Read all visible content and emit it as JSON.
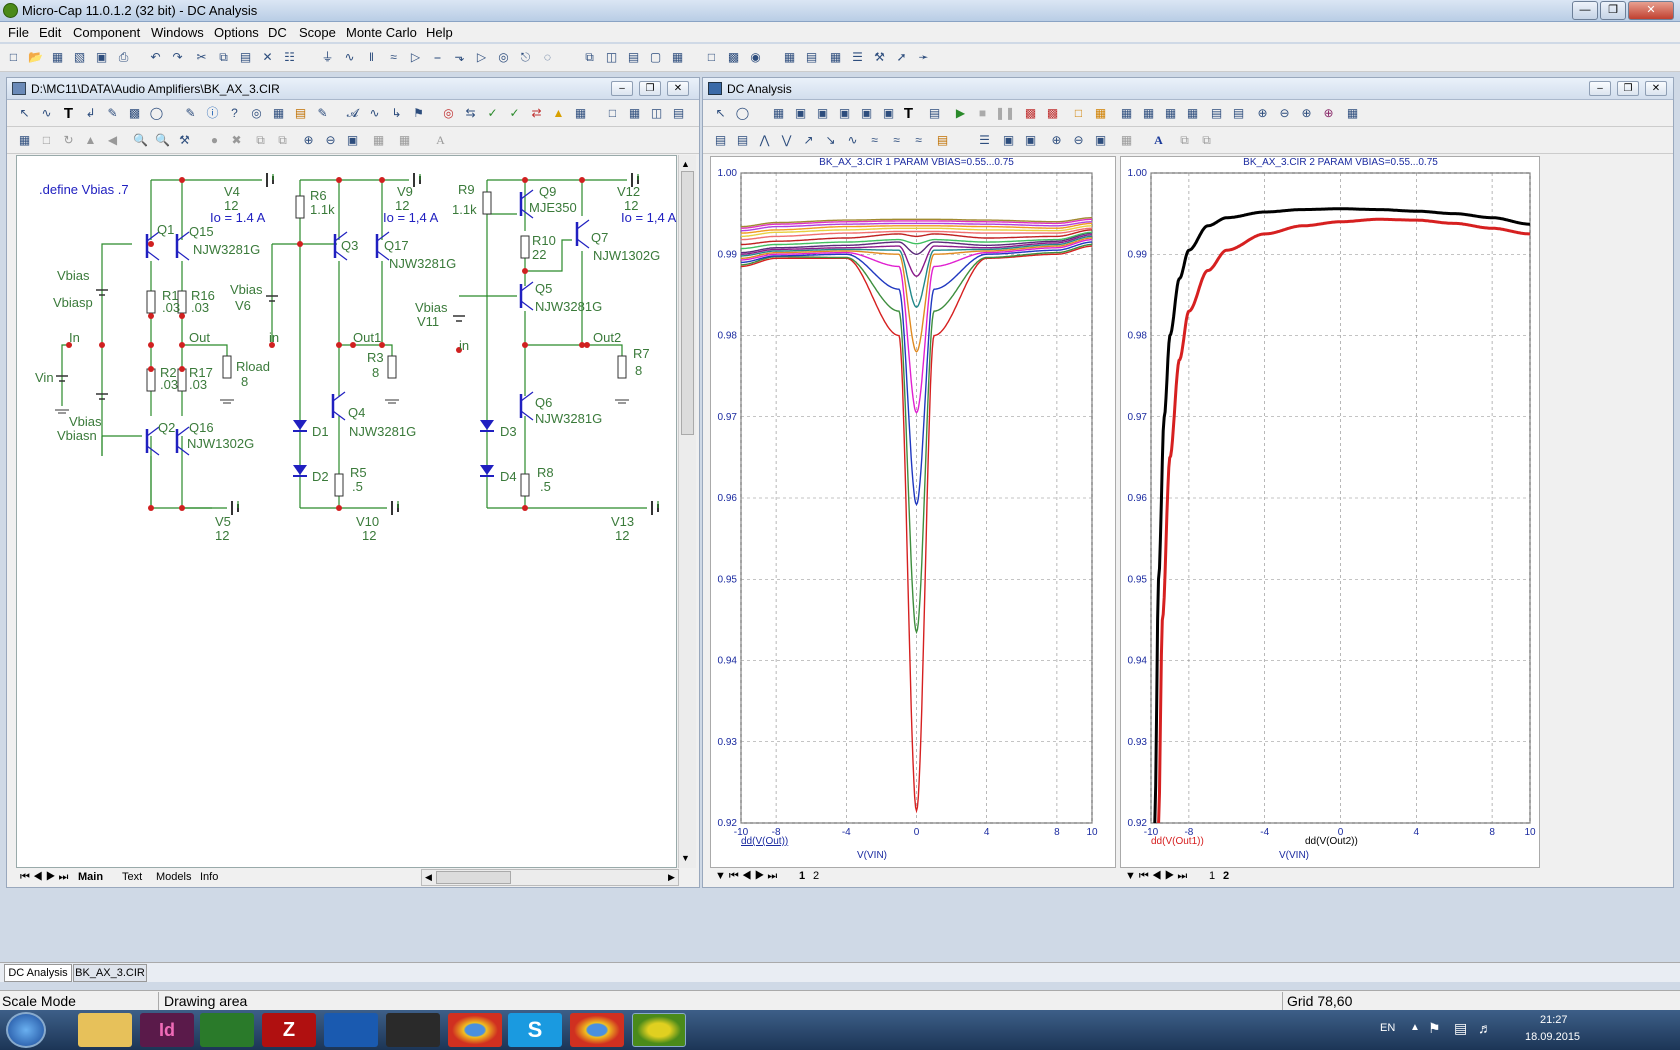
{
  "app": {
    "title": "Micro-Cap 11.0.1.2 (32 bit) - DC Analysis"
  },
  "menu": [
    "File",
    "Edit",
    "Component",
    "Windows",
    "Options",
    "DC",
    "Scope",
    "Monte Carlo",
    "Help"
  ],
  "schematic": {
    "title": "D:\\MC11\\DATA\\Audio Amplifiers\\BK_AX_3.CIR",
    "tabs": [
      "Main",
      "Text",
      "Models",
      "Info"
    ],
    "define": ".define Vbias .7",
    "labels": [
      {
        "t": "Q1",
        "c": "g"
      },
      {
        "t": "Q15",
        "c": "g"
      },
      {
        "t": "NJW3281G",
        "c": "g"
      },
      {
        "t": "V4",
        "c": "g"
      },
      {
        "t": "12",
        "c": "g"
      },
      {
        "t": "Io = 1.4 A",
        "c": "b"
      },
      {
        "t": "Vbias",
        "c": "g"
      },
      {
        "t": "Vbiasp",
        "c": "g"
      },
      {
        "t": "R1",
        "c": "g"
      },
      {
        "t": ".03",
        "c": "g"
      },
      {
        "t": "R16",
        "c": "g"
      },
      {
        "t": ".03",
        "c": "g"
      },
      {
        "t": "In",
        "c": "g"
      },
      {
        "t": "Out",
        "c": "g"
      },
      {
        "t": "Vin",
        "c": "g"
      },
      {
        "t": "R2",
        "c": "g"
      },
      {
        "t": ".03",
        "c": "g"
      },
      {
        "t": "R17",
        "c": "g"
      },
      {
        "t": ".03",
        "c": "g"
      },
      {
        "t": "Rload",
        "c": "g"
      },
      {
        "t": "8",
        "c": "g"
      },
      {
        "t": "Vbias",
        "c": "g"
      },
      {
        "t": "Vbiasn",
        "c": "g"
      },
      {
        "t": "Q2",
        "c": "g"
      },
      {
        "t": "Q16",
        "c": "g"
      },
      {
        "t": "NJW1302G",
        "c": "g"
      },
      {
        "t": "V5",
        "c": "g"
      },
      {
        "t": "12",
        "c": "g"
      },
      {
        "t": "R6",
        "c": "g"
      },
      {
        "t": "1.1k",
        "c": "g"
      },
      {
        "t": "V9",
        "c": "g"
      },
      {
        "t": "12",
        "c": "g"
      },
      {
        "t": "Io = 1,4 A",
        "c": "b"
      },
      {
        "t": "Q3",
        "c": "g"
      },
      {
        "t": "Q17",
        "c": "g"
      },
      {
        "t": "NJW3281G",
        "c": "g"
      },
      {
        "t": "Vbias",
        "c": "g"
      },
      {
        "t": "V6",
        "c": "g"
      },
      {
        "t": "in",
        "c": "g"
      },
      {
        "t": "Out1",
        "c": "g"
      },
      {
        "t": "R3",
        "c": "g"
      },
      {
        "t": "8",
        "c": "g"
      },
      {
        "t": "Q4",
        "c": "g"
      },
      {
        "t": "NJW3281G",
        "c": "g"
      },
      {
        "t": "D1",
        "c": "g"
      },
      {
        "t": "D2",
        "c": "g"
      },
      {
        "t": "R5",
        "c": "g"
      },
      {
        "t": ".5",
        "c": "g"
      },
      {
        "t": "V10",
        "c": "g"
      },
      {
        "t": "12",
        "c": "g"
      },
      {
        "t": "R9",
        "c": "g"
      },
      {
        "t": "1.1k",
        "c": "g"
      },
      {
        "t": "Q9",
        "c": "g"
      },
      {
        "t": "MJE350",
        "c": "g"
      },
      {
        "t": "V12",
        "c": "g"
      },
      {
        "t": "12",
        "c": "g"
      },
      {
        "t": "Io = 1,4 A",
        "c": "b"
      },
      {
        "t": "R10",
        "c": "g"
      },
      {
        "t": "22",
        "c": "g"
      },
      {
        "t": "Q7",
        "c": "g"
      },
      {
        "t": "NJW1302G",
        "c": "g"
      },
      {
        "t": "Q5",
        "c": "g"
      },
      {
        "t": "NJW3281G",
        "c": "g"
      },
      {
        "t": "Vbias",
        "c": "g"
      },
      {
        "t": "V11",
        "c": "g"
      },
      {
        "t": "in",
        "c": "g"
      },
      {
        "t": "Out2",
        "c": "g"
      },
      {
        "t": "R7",
        "c": "g"
      },
      {
        "t": "8",
        "c": "g"
      },
      {
        "t": "Q6",
        "c": "g"
      },
      {
        "t": "NJW3281G",
        "c": "g"
      },
      {
        "t": "D3",
        "c": "g"
      },
      {
        "t": "D4",
        "c": "g"
      },
      {
        "t": "R8",
        "c": "g"
      },
      {
        "t": ".5",
        "c": "g"
      },
      {
        "t": "V13",
        "c": "g"
      },
      {
        "t": "12",
        "c": "g"
      }
    ]
  },
  "analysis": {
    "title": "DC Analysis",
    "tabs": [
      "1",
      "2"
    ],
    "plot1": {
      "heading": "BK_AX_3.CIR 1 PARAM VBIAS=0.55...0.75",
      "ylabel": "dd(V(Out))",
      "xlabel": "V(VIN)"
    },
    "plot2": {
      "heading": "BK_AX_3.CIR 2 PARAM VBIAS=0.55...0.75",
      "ylabel1": "dd(V(Out1))",
      "ylabel2": "dd(V(Out2))",
      "xlabel": "V(VIN)"
    }
  },
  "chart_data": [
    {
      "type": "line",
      "title": "BK_AX_3.CIR 1 PARAM VBIAS=0.55...0.75",
      "xlabel": "V(VIN)",
      "ylabel": "dd(V(Out))",
      "xlim": [
        -10,
        10
      ],
      "ylim": [
        0.92,
        1.0
      ],
      "xticks": [
        -10,
        -8,
        -4,
        0,
        4,
        8,
        10
      ],
      "yticks": [
        0.92,
        0.93,
        0.94,
        0.95,
        0.96,
        0.97,
        0.98,
        0.99,
        1.0
      ],
      "grid": true,
      "series": [
        {
          "color": "#d62020",
          "values_at": {
            "x": [
              -10,
              -8,
              -4,
              -1,
              0,
              1,
              4,
              8,
              10
            ],
            "y": [
              0.9885,
              0.9895,
              0.9895,
              0.98,
              0.9215,
              0.98,
              0.9895,
              0.99,
              0.991
            ]
          }
        },
        {
          "color": "#3e8e3e",
          "values_at": {
            "x": [
              -10,
              -8,
              -4,
              -1,
              0,
              1,
              4,
              8,
              10
            ],
            "y": [
              0.9887,
              0.9897,
              0.9896,
              0.983,
              0.9435,
              0.983,
              0.9896,
              0.9902,
              0.9912
            ]
          }
        },
        {
          "color": "#2038c0",
          "values_at": {
            "x": [
              -10,
              -8,
              -4,
              -1,
              0,
              1,
              4,
              8,
              10
            ],
            "y": [
              0.989,
              0.9898,
              0.99,
              0.9857,
              0.9592,
              0.9857,
              0.99,
              0.9905,
              0.9915
            ]
          }
        },
        {
          "color": "#e020d0",
          "values_at": {
            "x": [
              -10,
              -8,
              -4,
              -1,
              0,
              1,
              4,
              8,
              10
            ],
            "y": [
              0.9893,
              0.99,
              0.9902,
              0.9885,
              0.9705,
              0.9885,
              0.9902,
              0.9908,
              0.9918
            ]
          }
        },
        {
          "color": "#e08a20",
          "values_at": {
            "x": [
              -10,
              -8,
              -4,
              -1,
              0,
              1,
              4,
              8,
              10
            ],
            "y": [
              0.9895,
              0.9902,
              0.9904,
              0.99,
              0.978,
              0.99,
              0.9904,
              0.991,
              0.992
            ]
          }
        },
        {
          "color": "#20888a",
          "values_at": {
            "x": [
              -10,
              -8,
              -4,
              -1,
              0,
              1,
              4,
              8,
              10
            ],
            "y": [
              0.9898,
              0.9904,
              0.9906,
              0.9905,
              0.9835,
              0.9905,
              0.9906,
              0.9912,
              0.9922
            ]
          }
        },
        {
          "color": "#8a1a8a",
          "values_at": {
            "x": [
              -10,
              -8,
              -4,
              -1,
              0,
              1,
              4,
              8,
              10
            ],
            "y": [
              0.99,
              0.9906,
              0.9908,
              0.991,
              0.9873,
              0.991,
              0.9908,
              0.9914,
              0.9924
            ]
          }
        },
        {
          "color": "#5a2a7a",
          "values_at": {
            "x": [
              -10,
              -8,
              -4,
              -1,
              0,
              1,
              4,
              8,
              10
            ],
            "y": [
              0.9902,
              0.9908,
              0.9911,
              0.9915,
              0.99,
              0.9915,
              0.9911,
              0.9916,
              0.9926
            ]
          }
        },
        {
          "color": "#40c060",
          "values_at": {
            "x": [
              -10,
              -8,
              -4,
              -1,
              0,
              1,
              4,
              8,
              10
            ],
            "y": [
              0.9907,
              0.9912,
              0.9915,
              0.9918,
              0.9913,
              0.9918,
              0.9915,
              0.9918,
              0.9927
            ]
          }
        },
        {
          "color": "#c02020",
          "values_at": {
            "x": [
              -10,
              -8,
              -4,
              -1,
              0,
              1,
              4,
              8,
              10
            ],
            "y": [
              0.9912,
              0.9916,
              0.992,
              0.9925,
              0.9922,
              0.9925,
              0.992,
              0.9922,
              0.993
            ]
          }
        },
        {
          "color": "#f07070",
          "values_at": {
            "x": [
              -10,
              -8,
              -4,
              -1,
              0,
              1,
              4,
              8,
              10
            ],
            "y": [
              0.9918,
              0.9922,
              0.9926,
              0.9928,
              0.9928,
              0.9928,
              0.9926,
              0.9926,
              0.9932
            ]
          }
        },
        {
          "color": "#e8d040",
          "values_at": {
            "x": [
              -10,
              -8,
              -4,
              -1,
              0,
              1,
              4,
              8,
              10
            ],
            "y": [
              0.9922,
              0.9927,
              0.993,
              0.9932,
              0.9932,
              0.9932,
              0.993,
              0.9929,
              0.9935
            ]
          }
        },
        {
          "color": "#f09a20",
          "values_at": {
            "x": [
              -10,
              -8,
              -4,
              -1,
              0,
              1,
              4,
              8,
              10
            ],
            "y": [
              0.9926,
              0.993,
              0.9934,
              0.9935,
              0.9935,
              0.9935,
              0.9934,
              0.9932,
              0.9938
            ]
          }
        },
        {
          "color": "#b040e0",
          "values_at": {
            "x": [
              -10,
              -8,
              -4,
              -1,
              0,
              1,
              4,
              8,
              10
            ],
            "y": [
              0.9929,
              0.9934,
              0.9937,
              0.9938,
              0.9938,
              0.9938,
              0.9937,
              0.9935,
              0.994
            ]
          }
        },
        {
          "color": "#e030c0",
          "values_at": {
            "x": [
              -10,
              -8,
              -4,
              -1,
              0,
              1,
              4,
              8,
              10
            ],
            "y": [
              0.9932,
              0.9937,
              0.994,
              0.9941,
              0.9941,
              0.9941,
              0.994,
              0.9938,
              0.9943
            ]
          }
        },
        {
          "color": "#a08a30",
          "values_at": {
            "x": [
              -10,
              -8,
              -4,
              -1,
              0,
              1,
              4,
              8,
              10
            ],
            "y": [
              0.9934,
              0.9939,
              0.9942,
              0.9943,
              0.9943,
              0.9943,
              0.9942,
              0.994,
              0.9945
            ]
          }
        }
      ]
    },
    {
      "type": "line",
      "title": "BK_AX_3.CIR 2 PARAM VBIAS=0.55...0.75",
      "xlabel": "V(VIN)",
      "xlim": [
        -10,
        10
      ],
      "ylim": [
        0.92,
        1.0
      ],
      "xticks": [
        -10,
        -8,
        -4,
        0,
        4,
        8,
        10
      ],
      "yticks": [
        0.92,
        0.93,
        0.94,
        0.95,
        0.96,
        0.97,
        0.98,
        0.99,
        1.0
      ],
      "grid": true,
      "series": [
        {
          "name": "dd(V(Out1))",
          "color": "#d62020",
          "values_at": {
            "x": [
              -9.6,
              -9.4,
              -9,
              -8.5,
              -8,
              -7,
              -6,
              -4,
              -2,
              0,
              2,
              4,
              6,
              8,
              10
            ],
            "y": [
              0.92,
              0.945,
              0.965,
              0.977,
              0.983,
              0.988,
              0.9905,
              0.9925,
              0.9935,
              0.994,
              0.9943,
              0.9942,
              0.9938,
              0.9932,
              0.9925
            ]
          }
        },
        {
          "name": "dd(V(Out2))",
          "color": "#000000",
          "values_at": {
            "x": [
              -9.8,
              -9.6,
              -9.3,
              -9,
              -8.5,
              -8,
              -7,
              -6,
              -4,
              -2,
              0,
              2,
              4,
              6,
              8,
              10
            ],
            "y": [
              0.92,
              0.95,
              0.97,
              0.98,
              0.987,
              0.9905,
              0.9935,
              0.9945,
              0.9952,
              0.9955,
              0.9956,
              0.9955,
              0.9953,
              0.995,
              0.9945,
              0.9937
            ]
          }
        }
      ]
    }
  ],
  "bottom_tabs": [
    "DC Analysis",
    "BK_AX_3.CIR"
  ],
  "status": {
    "mode": "Scale Mode",
    "area": "Drawing area",
    "grid": "Grid 78,60"
  },
  "taskbar": {
    "lang": "EN",
    "time": "21:27",
    "date": "18.09.2015"
  }
}
